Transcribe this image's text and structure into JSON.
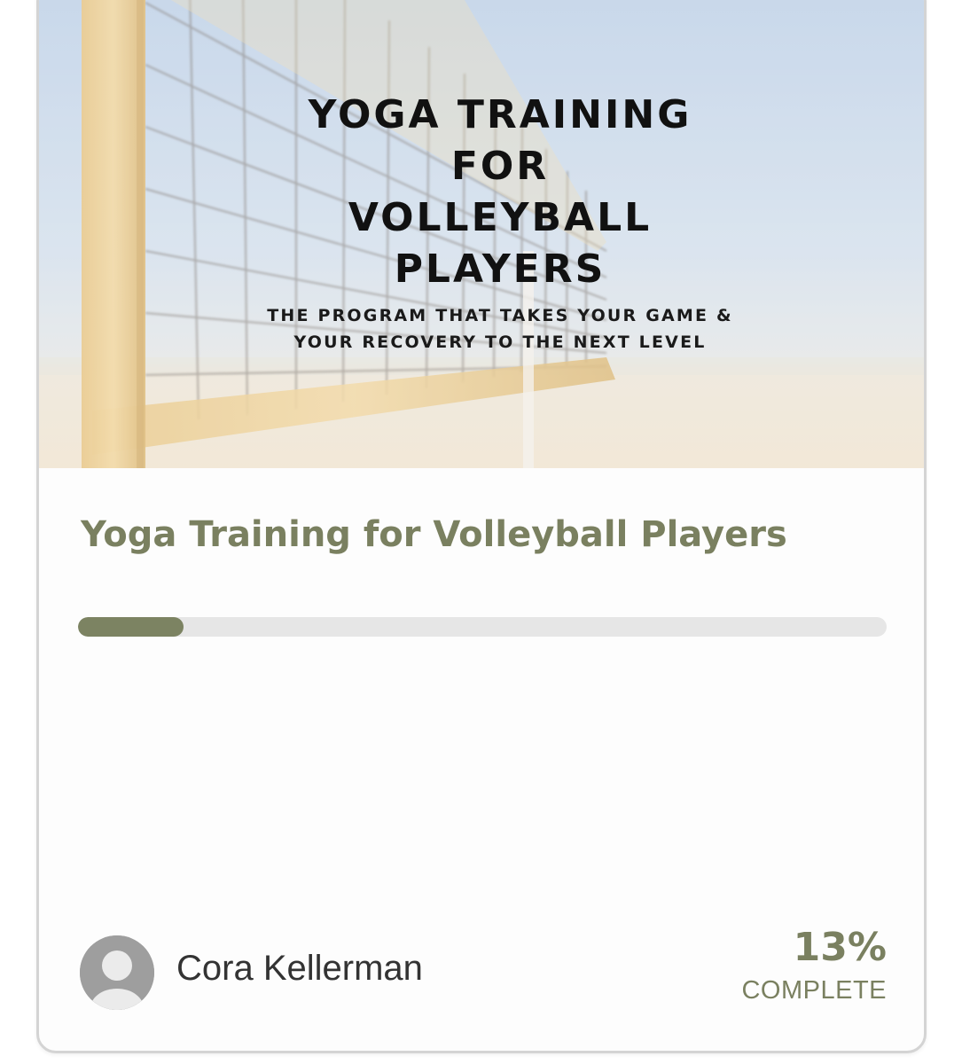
{
  "course": {
    "hero_title_lines": [
      "YOGA TRAINING",
      "FOR",
      "VOLLEYBALL",
      "PLAYERS"
    ],
    "hero_subtitle_lines": [
      "THE PROGRAM THAT TAKES YOUR GAME &",
      "YOUR RECOVERY TO THE NEXT LEVEL"
    ],
    "title": "Yoga Training for Volleyball Players",
    "progress_percent": 13,
    "percent_label": "13%",
    "complete_label": "COMPLETE",
    "author": {
      "name": "Cora Kellerman",
      "avatar_icon": "user-avatar-icon"
    }
  },
  "colors": {
    "accent": "#7a8060",
    "progress_fill": "#7c8362",
    "progress_track": "#e6e6e6",
    "card_border": "#d4d4d4"
  }
}
